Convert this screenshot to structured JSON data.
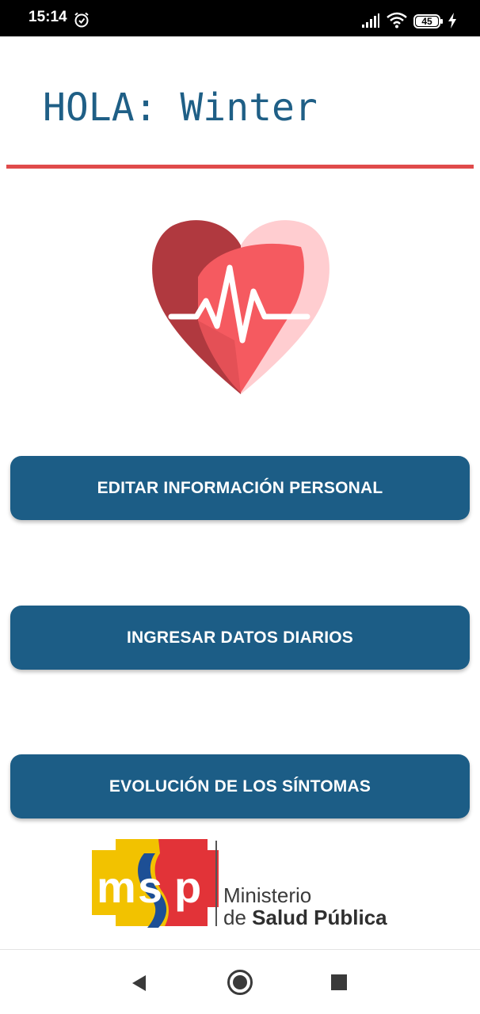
{
  "status_bar": {
    "time": "15:14",
    "battery_level": "45",
    "icons": [
      "alarm-icon",
      "signal-icon",
      "wifi-icon",
      "battery-icon",
      "charging-icon"
    ]
  },
  "header": {
    "greeting": "HOLA: Winter",
    "accent_color": "#e04b4b",
    "text_color": "#1f5f86"
  },
  "illustration": {
    "icon": "heart-pulse-icon"
  },
  "buttons": {
    "edit_personal": "EDITAR INFORMACIÓN PERSONAL",
    "daily_data": "INGRESAR DATOS DIARIOS",
    "symptoms": "EVOLUCIÓN DE LOS SÍNTOMAS",
    "color": "#1c5d86"
  },
  "logo": {
    "acronym": "msp",
    "line1": "Ministerio",
    "line2_prefix": "de ",
    "line2_bold": "Salud Pública"
  },
  "nav_bar": {
    "icons": [
      "back-icon",
      "home-icon",
      "recent-apps-icon"
    ]
  }
}
